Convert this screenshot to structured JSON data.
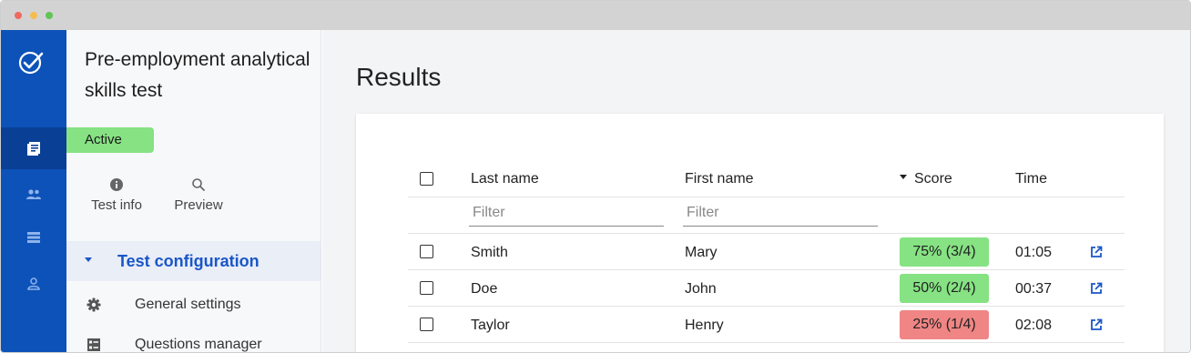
{
  "sidebar": {
    "test_title": "Pre-employment analytical skills test",
    "status": "Active",
    "actions": [
      {
        "label": "Test info",
        "icon": "info-icon"
      },
      {
        "label": "Preview",
        "icon": "search-icon"
      }
    ],
    "section": {
      "label": "Test configuration"
    },
    "menu": [
      {
        "label": "General settings",
        "icon": "gear-icon"
      },
      {
        "label": "Questions manager",
        "icon": "list-icon"
      }
    ]
  },
  "main": {
    "title": "Results",
    "table": {
      "columns": [
        "Last name",
        "First name",
        "Score",
        "Time"
      ],
      "filter_placeholder": "Filter",
      "rows": [
        {
          "last": "Smith",
          "first": "Mary",
          "score": "75% (3/4)",
          "score_status": "pass",
          "time": "01:05"
        },
        {
          "last": "Doe",
          "first": "John",
          "score": "50% (2/4)",
          "score_status": "pass",
          "time": "00:37"
        },
        {
          "last": "Taylor",
          "first": "Henry",
          "score": "25% (1/4)",
          "score_status": "fail",
          "time": "02:08"
        }
      ]
    }
  },
  "colors": {
    "rail": "#0d52b8",
    "accent": "#1a56c8",
    "pass": "#86e283",
    "fail": "#f08585"
  }
}
